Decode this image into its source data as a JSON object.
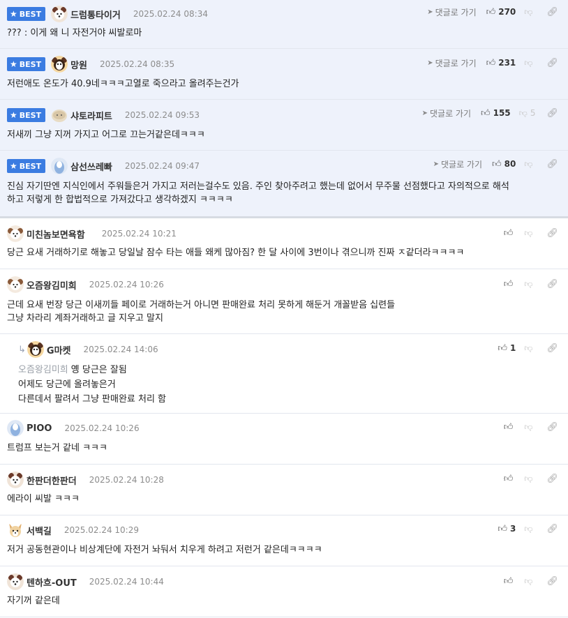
{
  "labels": {
    "best": "BEST",
    "go_to_reply": "댓글로 가기"
  },
  "comments": [
    {
      "best": true,
      "nick": "드럼통타이거",
      "date": "2025.02.24 08:34",
      "up": "270",
      "down": "",
      "lines": [
        "??? : 이게 왜 니 자전거야 씨발로마"
      ]
    },
    {
      "best": true,
      "nick": "망원",
      "date": "2025.02.24 08:35",
      "up": "231",
      "down": "",
      "lines": [
        "저런애도 온도가 40.9네ㅋㅋㅋ고열로 죽으라고 올려주는건가"
      ]
    },
    {
      "best": true,
      "nick": "샤토라피트",
      "date": "2025.02.24 09:53",
      "up": "155",
      "down": "5",
      "lines": [
        "저새끼 그냥 지꺼 가지고 어그로 끄는거같은데ㅋㅋㅋ"
      ]
    },
    {
      "best": true,
      "nick": "삼선쓰레빠",
      "date": "2025.02.24 09:47",
      "up": "80",
      "down": "",
      "lines": [
        "진심 자기딴엔 지식인에서 주워들은거 가지고 저러는걸수도 있음. 주인 찾아주려고 했는데 없어서 무주물 선점했다고 자의적으로 해석",
        "하고 저렇게 한 합법적으로 가져갔다고 생각하겠지 ㅋㅋㅋㅋ"
      ]
    },
    {
      "best": false,
      "nick": "미친놈보면욕함",
      "date": "2025.02.24 10:21",
      "up": "",
      "down": "",
      "lines": [
        "당근 요새 거래하기로 해놓고 당일날 잠수 타는 애들 왜케 많아짐? 한 달 사이에 3번이나 겪으니까 진짜 ㅈ같더라ㅋㅋㅋㅋ"
      ]
    },
    {
      "best": false,
      "nick": "오즘왕김미희",
      "date": "2025.02.24 10:26",
      "up": "",
      "down": "",
      "lines": [
        "근데 요새 번장 당근 이새끼들 페이로 거래하는거 아니면 판매완료 처리 못하게 해둔거 개꼴받음 십련들",
        "그냥 차라리 계좌거래하고 글 지우고 말지"
      ]
    },
    {
      "best": false,
      "reply": true,
      "nick": "G마켓",
      "date": "2025.02.24 14:06",
      "up": "1",
      "down": "",
      "mention": "오즘왕김미희",
      "lines": [
        "옝 당근은 잘됨",
        "어제도 당근에 올려놓은거",
        "다른데서 팔려서 그냥 판매완료 처리 함"
      ]
    },
    {
      "best": false,
      "nick": "PIOO",
      "date": "2025.02.24 10:26",
      "up": "",
      "down": "",
      "lines": [
        "트럼프 보는거 같네 ㅋㅋㅋ"
      ]
    },
    {
      "best": false,
      "nick": "한판더한판더",
      "date": "2025.02.24 10:28",
      "up": "",
      "down": "",
      "lines": [
        "에라이 씨발 ㅋㅋㅋ"
      ]
    },
    {
      "best": false,
      "nick": "서백길",
      "date": "2025.02.24 10:29",
      "up": "3",
      "down": "",
      "lines": [
        "저거 공동현관이나 비상계단에 자전거 놔둬서 치우게 하려고 저런거 같은데ㅋㅋㅋㅋ"
      ]
    },
    {
      "best": false,
      "nick": "텐하흐-OUT",
      "date": "2025.02.24 10:44",
      "up": "",
      "down": "",
      "lines": [
        "자기꺼 같은데"
      ]
    }
  ],
  "icons": {
    "thumb_up": "thumb-up-icon",
    "thumb_down": "thumb-down-icon",
    "link": "link-icon",
    "arrow": "navigation-arrow-icon",
    "star": "star-icon",
    "reply": "reply-arrow-icon"
  },
  "colors": {
    "best_bg": "#eef2fb",
    "badge": "#3b7ce1",
    "divider": "#e2e6ee"
  }
}
